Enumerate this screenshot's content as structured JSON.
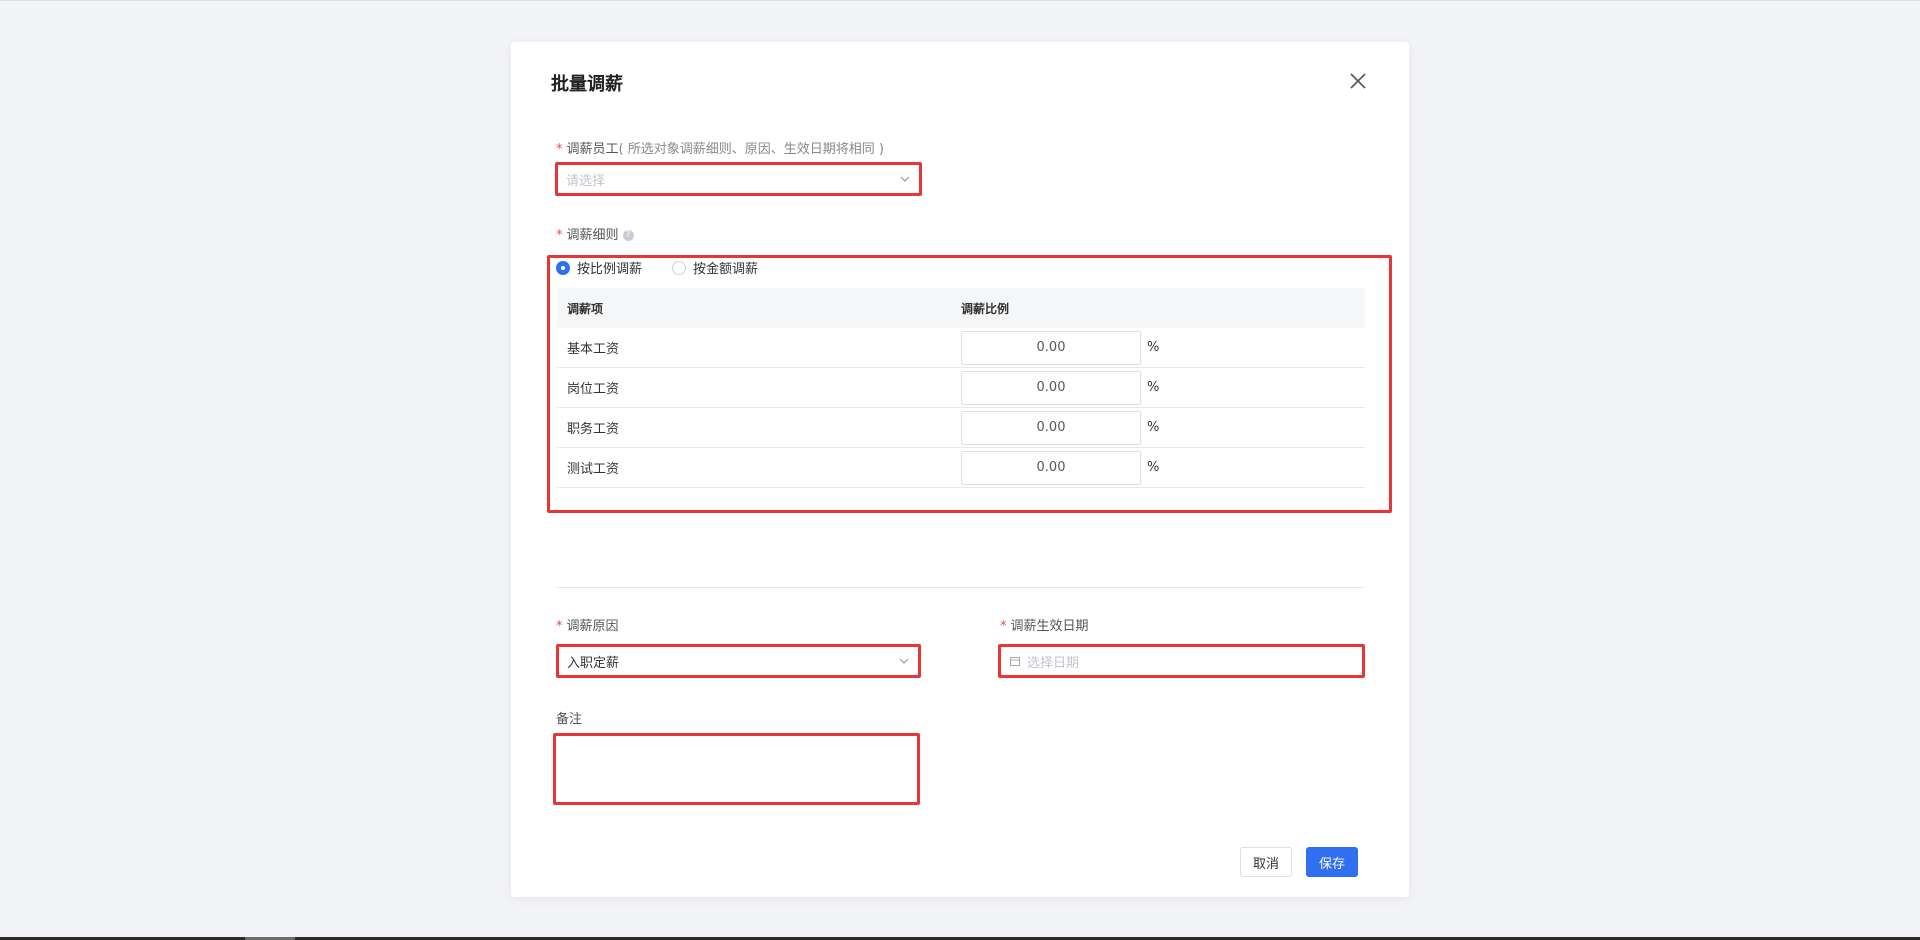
{
  "dialog": {
    "title": "批量调薪",
    "employees": {
      "label": "调薪员工",
      "hint": "( 所选对象调薪细则、原因、生效日期将相同 )",
      "placeholder": "请选择"
    },
    "rules": {
      "label": "调薪细则",
      "options": [
        "按比例调薪",
        "按金额调薪"
      ],
      "selected": "按比例调薪",
      "columns": [
        "调薪项",
        "调薪比例"
      ],
      "rows": [
        {
          "item": "基本工资",
          "value": "0.00",
          "unit": "%"
        },
        {
          "item": "岗位工资",
          "value": "0.00",
          "unit": "%"
        },
        {
          "item": "职务工资",
          "value": "0.00",
          "unit": "%"
        },
        {
          "item": "测试工资",
          "value": "0.00",
          "unit": "%"
        }
      ]
    },
    "reason": {
      "label": "调薪原因",
      "value": "入职定薪"
    },
    "effective_date": {
      "label": "调薪生效日期",
      "placeholder": "选择日期"
    },
    "remark": {
      "label": "备注",
      "value": ""
    },
    "buttons": {
      "cancel": "取消",
      "save": "保存"
    }
  },
  "colors": {
    "primary": "#2f6ff0",
    "highlight": "#e83535",
    "required": "#e34d4d"
  }
}
